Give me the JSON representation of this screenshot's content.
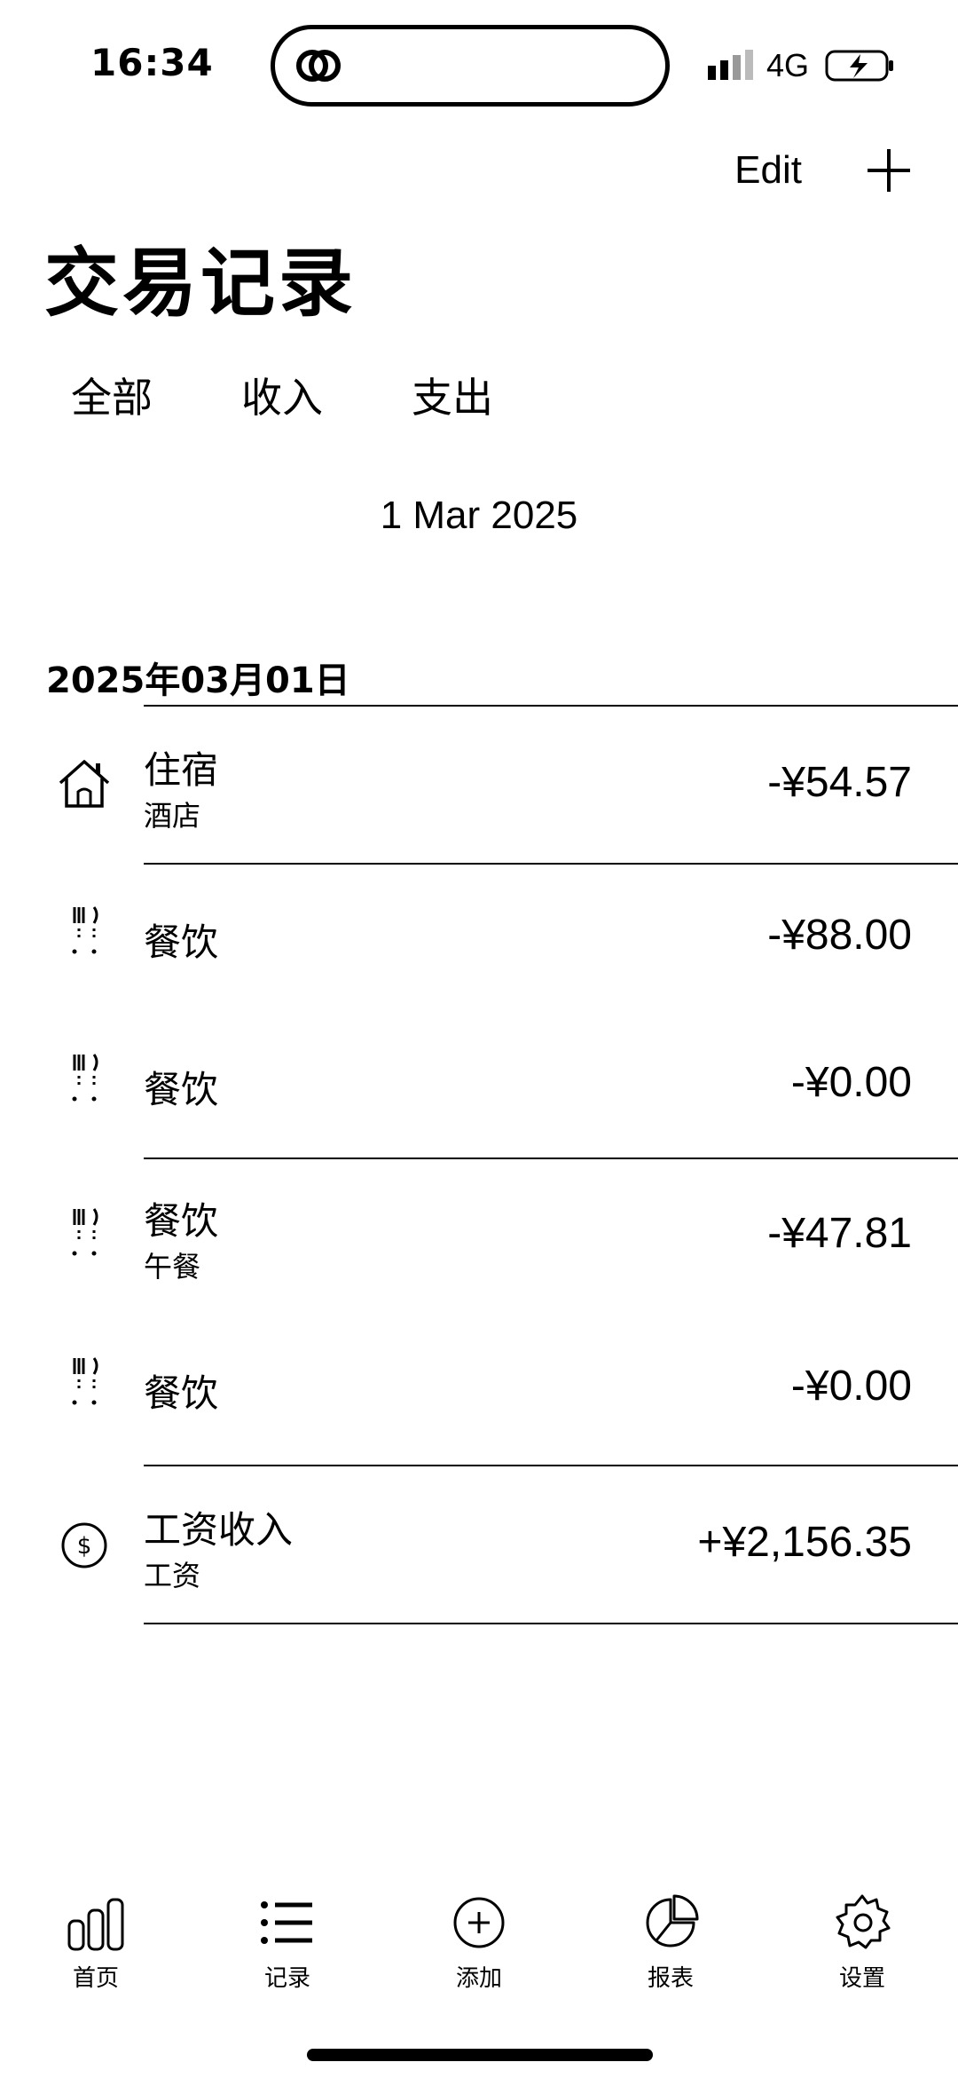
{
  "status_bar": {
    "time": "16:34",
    "network": "4G"
  },
  "header": {
    "edit_label": "Edit",
    "title": "交易记录"
  },
  "filter_tabs": [
    {
      "label": "全部"
    },
    {
      "label": "收入"
    },
    {
      "label": "支出"
    }
  ],
  "date_picker": {
    "value": "1 Mar 2025"
  },
  "section": {
    "date_header": "2025年03月01日"
  },
  "transactions": [
    {
      "icon": "house-icon",
      "title": "住宿",
      "subtitle": "酒店",
      "amount": "-¥54.57"
    },
    {
      "icon": "fork-knife-icon",
      "title": "餐饮",
      "subtitle": "",
      "amount": "-¥88.00"
    },
    {
      "icon": "fork-knife-icon",
      "title": "餐饮",
      "subtitle": "",
      "amount": "-¥0.00"
    },
    {
      "icon": "fork-knife-icon",
      "title": "餐饮",
      "subtitle": "午餐",
      "amount": "-¥47.81"
    },
    {
      "icon": "fork-knife-icon",
      "title": "餐饮",
      "subtitle": "",
      "amount": "-¥0.00"
    },
    {
      "icon": "dollar-circle-icon",
      "title": "工资收入",
      "subtitle": "工资",
      "amount": "+¥2,156.35"
    }
  ],
  "tab_bar": [
    {
      "label": "首页",
      "icon": "bar-chart-icon"
    },
    {
      "label": "记录",
      "icon": "list-icon"
    },
    {
      "label": "添加",
      "icon": "plus-circle-icon"
    },
    {
      "label": "报表",
      "icon": "pie-chart-icon"
    },
    {
      "label": "设置",
      "icon": "gear-icon"
    }
  ]
}
